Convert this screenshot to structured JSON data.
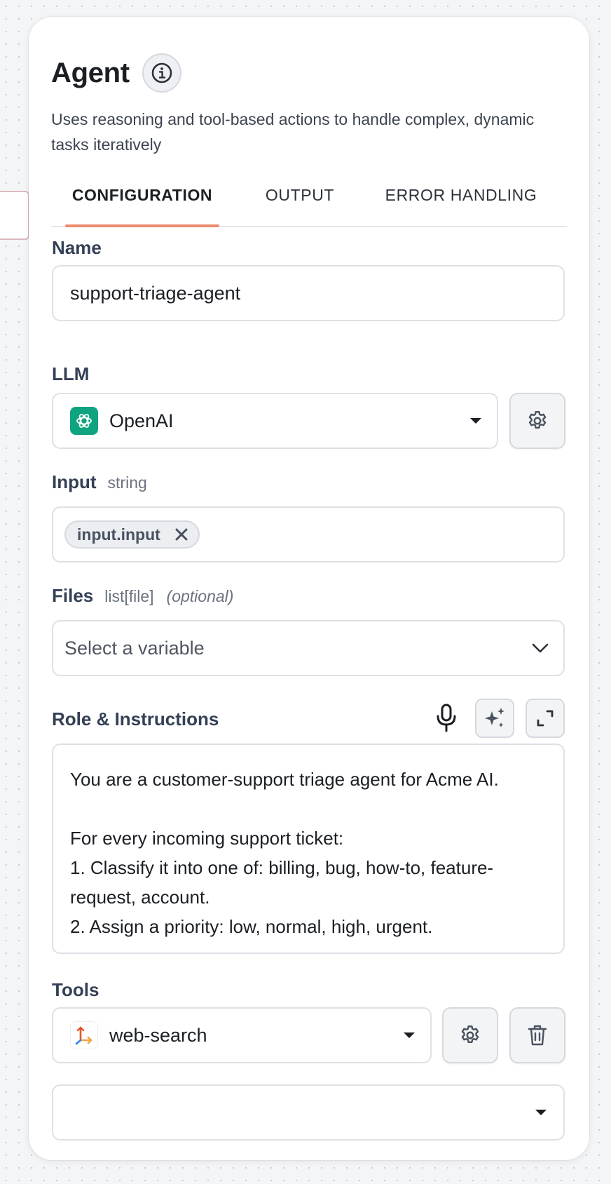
{
  "agent": {
    "title": "Agent",
    "description": "Uses reasoning and tool-based actions to handle complex, dynamic tasks iteratively"
  },
  "tabs": [
    {
      "label": "CONFIGURATION",
      "active": true
    },
    {
      "label": "OUTPUT",
      "active": false
    },
    {
      "label": "ERROR HANDLING",
      "active": false
    }
  ],
  "name": {
    "label": "Name",
    "value": "support-triage-agent"
  },
  "llm": {
    "label": "LLM",
    "value": "OpenAI",
    "icon": "openai-logo-icon"
  },
  "input": {
    "label": "Input",
    "type": "string",
    "chip": "input.input"
  },
  "files": {
    "label": "Files",
    "type": "list[file]",
    "optional": "(optional)",
    "placeholder": "Select a variable"
  },
  "instructions": {
    "label": "Role & Instructions",
    "text": "You are a customer-support triage agent for Acme AI.\n\nFor every incoming support ticket:\n1. Classify it into one of: billing, bug, how-to, feature-request, account.\n2. Assign a priority: low, normal, high, urgent."
  },
  "tools": {
    "label": "Tools",
    "items": [
      {
        "value": "web-search",
        "icon": "web-search-tool-icon"
      }
    ]
  },
  "colors": {
    "accent": "#ee8a6e",
    "openai": "#10a37f",
    "label": "#344055"
  }
}
